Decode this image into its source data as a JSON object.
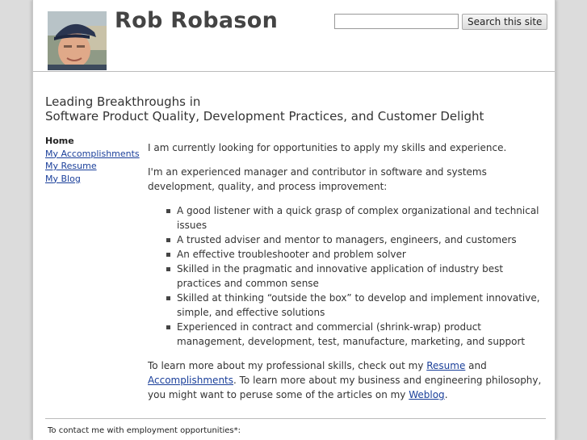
{
  "header": {
    "title": "Rob Robason",
    "search": {
      "placeholder": "",
      "value": "",
      "button_label": "Search this site"
    }
  },
  "tagline": {
    "line1": "Leading Breakthroughs in",
    "line2": "Software Product Quality, Development Practices, and Customer Delight"
  },
  "sidebar": {
    "current": "Home",
    "links": [
      "My Accomplishments",
      "My Resume",
      "My Blog"
    ]
  },
  "main": {
    "intro": "I am currently looking for opportunities to apply my skills and experience.",
    "summary": "I'm an experienced manager and contributor in software and systems development, quality, and process improvement:",
    "bullets": [
      "A good listener with a quick grasp of complex organizational and technical issues",
      "A trusted adviser and mentor to managers, engineers, and customers",
      "An effective troubleshooter and problem solver",
      "Skilled in the pragmatic and innovative application of industry best practices and common sense",
      "Skilled at thinking “outside the box” to develop and implement innovative, simple, and effective solutions",
      "Experienced in contract and commercial (shrink-wrap) product management, development, test, manufacture, marketing, and support"
    ],
    "closing": {
      "part1": "To learn more about my professional skills, check out my ",
      "link_resume": "Resume",
      "part2": " and ",
      "link_accomplishments": "Accomplishments",
      "part3": ". To learn more about my business and engineering philosophy, you might want to peruse some of the articles on my ",
      "link_weblog": "Weblog",
      "part4": "."
    }
  },
  "footer": {
    "contact": "To contact me with employment opportunities*:"
  }
}
